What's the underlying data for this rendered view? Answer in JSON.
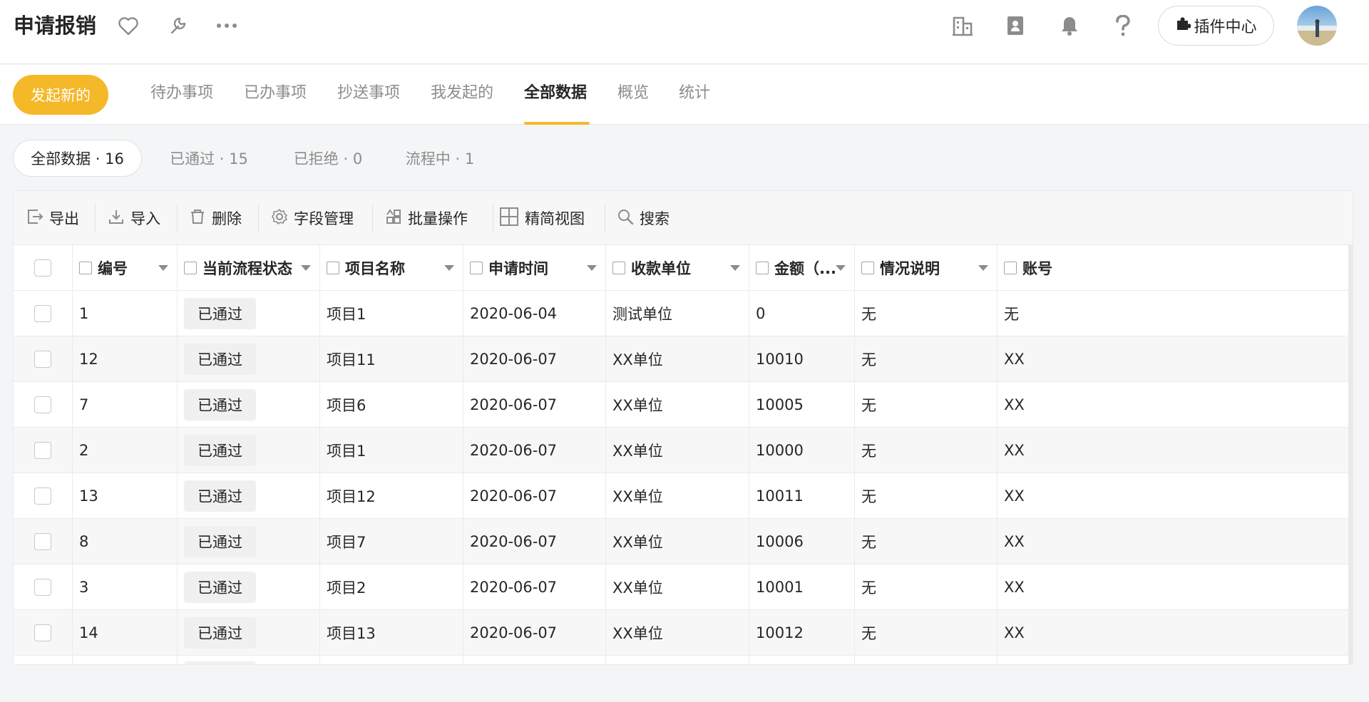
{
  "header": {
    "title": "申请报销",
    "plugin_label": "插件中心"
  },
  "nav": {
    "new_button": "发起新的",
    "tabs": [
      {
        "label": "待办事项",
        "active": false
      },
      {
        "label": "已办事项",
        "active": false
      },
      {
        "label": "抄送事项",
        "active": false
      },
      {
        "label": "我发起的",
        "active": false
      },
      {
        "label": "全部数据",
        "active": true
      },
      {
        "label": "概览",
        "active": false
      },
      {
        "label": "统计",
        "active": false
      }
    ],
    "accent_color": "#f5b829"
  },
  "filters": [
    {
      "label": "全部数据 · 16",
      "active": true
    },
    {
      "label": "已通过 · 15",
      "active": false
    },
    {
      "label": "已拒绝 · 0",
      "active": false
    },
    {
      "label": "流程中 · 1",
      "active": false
    }
  ],
  "toolbar": {
    "export": "导出",
    "import": "导入",
    "delete": "删除",
    "fields": "字段管理",
    "batch": "批量操作",
    "compact_view": "精简视图",
    "search": "搜索"
  },
  "table": {
    "columns": [
      "编号",
      "当前流程状态",
      "项目名称",
      "申请时间",
      "收款单位",
      "金额（...",
      "情况说明",
      "账号"
    ],
    "rows": [
      [
        "1",
        "已通过",
        "项目1",
        "2020-06-04",
        "测试单位",
        "0",
        "无",
        "无"
      ],
      [
        "12",
        "已通过",
        "项目11",
        "2020-06-07",
        "XX单位",
        "10010",
        "无",
        "XX"
      ],
      [
        "7",
        "已通过",
        "项目6",
        "2020-06-07",
        "XX单位",
        "10005",
        "无",
        "XX"
      ],
      [
        "2",
        "已通过",
        "项目1",
        "2020-06-07",
        "XX单位",
        "10000",
        "无",
        "XX"
      ],
      [
        "13",
        "已通过",
        "项目12",
        "2020-06-07",
        "XX单位",
        "10011",
        "无",
        "XX"
      ],
      [
        "8",
        "已通过",
        "项目7",
        "2020-06-07",
        "XX单位",
        "10006",
        "无",
        "XX"
      ],
      [
        "3",
        "已通过",
        "项目2",
        "2020-06-07",
        "XX单位",
        "10001",
        "无",
        "XX"
      ],
      [
        "14",
        "已通过",
        "项目13",
        "2020-06-07",
        "XX单位",
        "10012",
        "无",
        "XX"
      ]
    ]
  }
}
